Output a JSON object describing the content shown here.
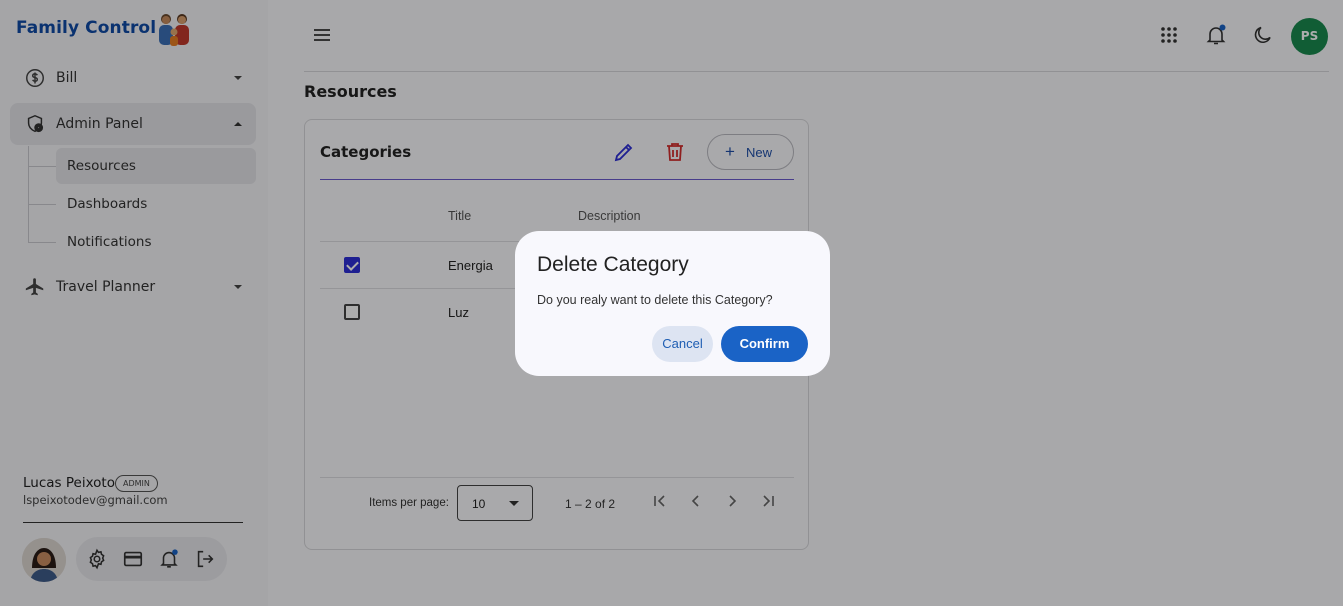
{
  "app": {
    "brand": "Family Control"
  },
  "sidebar": {
    "items": [
      {
        "label": "Bill",
        "icon": "dollar-circle-icon"
      },
      {
        "label": "Admin Panel",
        "icon": "shield-gear-icon",
        "expanded": true,
        "children": [
          {
            "label": "Resources",
            "active": true
          },
          {
            "label": "Dashboards"
          },
          {
            "label": "Notifications"
          }
        ]
      },
      {
        "label": "Travel Planner",
        "icon": "airplane-icon"
      }
    ],
    "user": {
      "name": "Lucas Peixoto",
      "role": "ADMIN",
      "email": "lspeixotodev@gmail.com"
    }
  },
  "topbar": {
    "profile_initials": "PS",
    "accent": "#1a8a4f"
  },
  "page": {
    "title": "Resources"
  },
  "card": {
    "title": "Categories",
    "new_label": "New",
    "columns": [
      "Title",
      "Description"
    ],
    "rows": [
      {
        "title": "Energia",
        "checked": true
      },
      {
        "title": "Luz",
        "checked": false
      }
    ],
    "paginator": {
      "items_per_page_label": "Items per page:",
      "page_size": "10",
      "range": "1 – 2 of 2"
    }
  },
  "dialog": {
    "title": "Delete Category",
    "message": "Do you realy want to delete this Category?",
    "cancel": "Cancel",
    "confirm": "Confirm"
  },
  "colors": {
    "brand": "#0f4aa5",
    "primary": "#1a63c6",
    "delete": "#d32f2f",
    "checkbox": "#2d2ed6"
  }
}
